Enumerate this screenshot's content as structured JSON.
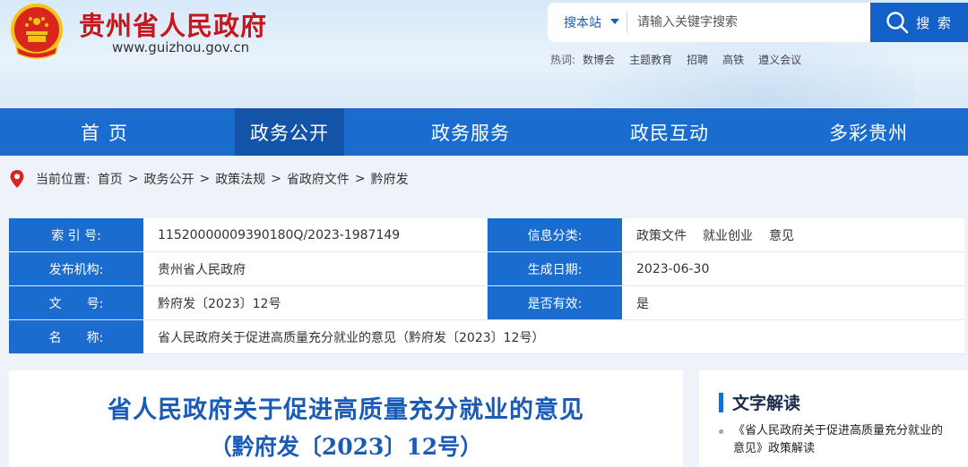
{
  "header": {
    "site_name": "贵州省人民政府",
    "site_url": "www.guizhou.gov.cn",
    "search": {
      "scope": "搜本站",
      "placeholder": "请输入关键字搜索",
      "button_label": "搜 索"
    },
    "hotwords": {
      "label": "热词:",
      "items": [
        "数博会",
        "主题教育",
        "招聘",
        "高铁",
        "遵义会议"
      ]
    }
  },
  "nav": {
    "items": [
      "首页",
      "政务公开",
      "政务服务",
      "政民互动",
      "多彩贵州"
    ],
    "active": "政务公开"
  },
  "breadcrumb": {
    "label": "当前位置:",
    "items": [
      "首页",
      "政务公开",
      "政策法规",
      "省政府文件",
      "黔府发"
    ],
    "separator": ">"
  },
  "info": {
    "index_label": "索 引 号:",
    "index_value": "11520000009390180Q/2023-1987149",
    "category_label": "信息分类:",
    "category_values": [
      "政策文件",
      "就业创业",
      "意见"
    ],
    "publisher_label": "发布机构:",
    "publisher_value": "贵州省人民政府",
    "date_label": "生成日期:",
    "date_value": "2023-06-30",
    "doc_no_label": "文　　号:",
    "doc_no_value": "黔府发〔2023〕12号",
    "valid_label": "是否有效:",
    "valid_value": "是",
    "name_label": "名　　称:",
    "name_value": "省人民政府关于促进高质量充分就业的意见（黔府发〔2023〕12号）"
  },
  "article": {
    "title": "省人民政府关于促进高质量充分就业的意见",
    "subtitle": "（黔府发〔2023〕12号）"
  },
  "side": {
    "title": "文字解读",
    "link": "《省人民政府关于促进高质量充分就业的意见》政策解读"
  },
  "colors": {
    "brand_red": "#c8161d",
    "nav_blue": "#1a6dce",
    "nav_active": "#1353a8",
    "title_blue": "#1a5bb8"
  }
}
